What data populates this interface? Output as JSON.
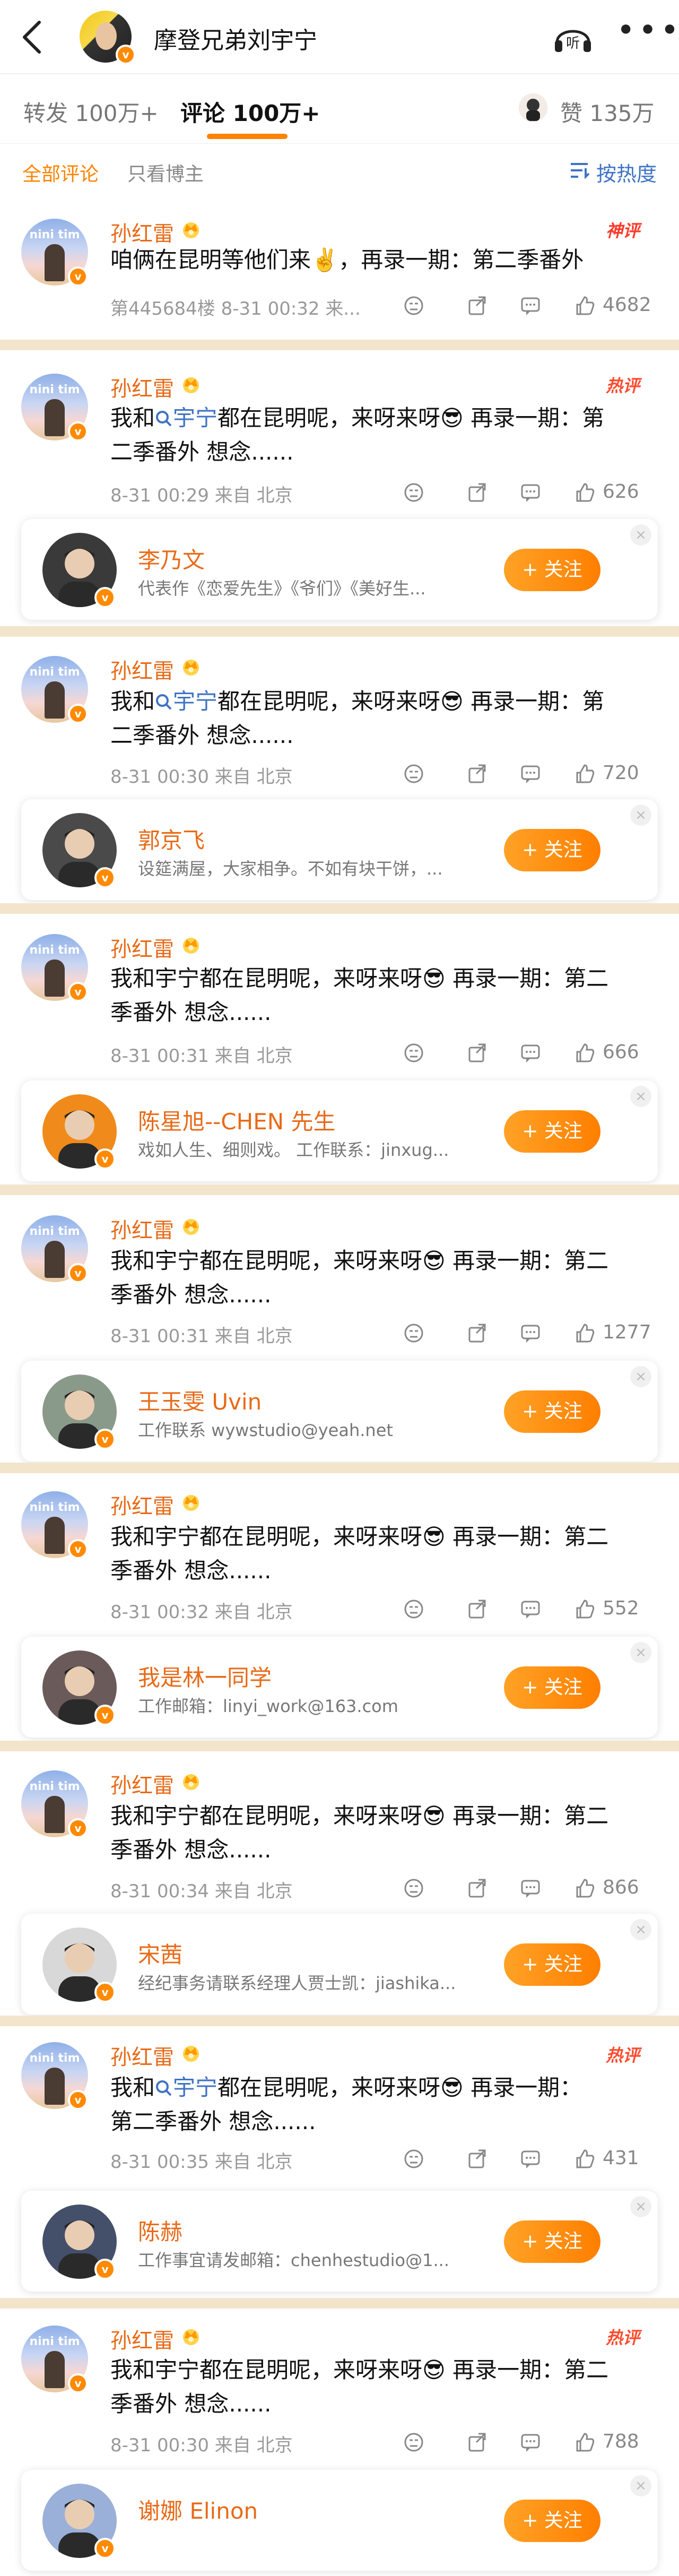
{
  "nav": {
    "title": "摩登兄弟刘宇宁",
    "listen_label": "听",
    "more_label": "•••"
  },
  "tabs": {
    "repost": "转发 100万+",
    "comment": "评论 100万+",
    "like": "赞 135万"
  },
  "filter": {
    "all": "全部评论",
    "owner_only": "只看博主",
    "sort": "按热度"
  },
  "colors": {
    "accent": "#ff8200",
    "username": "#e86a17",
    "link": "#3f73c5",
    "divider": "#f3e5cb"
  },
  "comments": [
    {
      "user": "孙红雷",
      "tag": "神评",
      "text_parts": [
        "咱俩在昆明等他们来✌️，再录一期：第二季番外"
      ],
      "meta": "第445684楼 8-31 00:32 来...",
      "likes": "4682"
    },
    {
      "user": "孙红雷",
      "tag": "热评",
      "text_parts": [
        "我和",
        "宇宁",
        "都在昆明呢，来呀来呀😎 再录一期：第",
        "二季番外 想念......"
      ],
      "meta": "8-31 00:29  来自 北京",
      "likes": "626",
      "card": {
        "name": "李乃文",
        "desc": "代表作《恋爱先生》《爷们》《美好生..."
      }
    },
    {
      "user": "孙红雷",
      "tag": "",
      "text_parts": [
        "我和",
        "宇宁",
        "都在昆明呢，来呀来呀😎 再录一期：第",
        "二季番外 想念......"
      ],
      "meta": "8-31 00:30  来自 北京",
      "likes": "720",
      "card": {
        "name": "郭京飞",
        "desc": "设筵满屋，大家相争。不如有块干饼，..."
      }
    },
    {
      "user": "孙红雷",
      "tag": "",
      "text_parts": [
        "我和宇宁都在昆明呢，来呀来呀😎 再录一期：第二",
        "季番外 想念......"
      ],
      "meta": "8-31 00:31  来自 北京",
      "likes": "666",
      "card": {
        "name": "陈星旭--CHEN 先生",
        "desc": "戏如人生、细则戏。 工作联系：jinxug..."
      }
    },
    {
      "user": "孙红雷",
      "tag": "",
      "text_parts": [
        "我和宇宁都在昆明呢，来呀来呀😎 再录一期：第二",
        "季番外 想念......"
      ],
      "meta": "8-31 00:31  来自 北京",
      "likes": "1277",
      "card": {
        "name": "王玉雯 Uvin",
        "desc": "工作联系 wywstudio@yeah.net"
      }
    },
    {
      "user": "孙红雷",
      "tag": "",
      "text_parts": [
        "我和宇宁都在昆明呢，来呀来呀😎 再录一期：第二",
        "季番外 想念......"
      ],
      "meta": "8-31 00:32  来自 北京",
      "likes": "552",
      "card": {
        "name": "我是林一同学",
        "desc": "工作邮箱：linyi_work@163.com"
      }
    },
    {
      "user": "孙红雷",
      "tag": "",
      "text_parts": [
        "我和宇宁都在昆明呢，来呀来呀😎 再录一期：第二",
        "季番外 想念......"
      ],
      "meta": "8-31 00:34  来自 北京",
      "likes": "866",
      "card": {
        "name": "宋茜",
        "desc": "经纪事务请联系经理人贾士凯：jiashika..."
      }
    },
    {
      "user": "孙红雷",
      "tag": "热评",
      "text_parts": [
        "我和",
        "宇宁",
        "都在昆明呢，来呀来呀😎  再录一期：",
        "第二季番外  想念......"
      ],
      "meta": "8-31 00:35  来自 北京",
      "likes": "431",
      "card": {
        "name": "陈赫",
        "desc": "工作事宜请发邮箱：chenhestudio@1..."
      }
    },
    {
      "user": "孙红雷",
      "tag": "热评",
      "text_parts": [
        "我和宇宁都在昆明呢，来呀来呀😎 再录一期：第二",
        "季番外 想念......"
      ],
      "meta": "8-31 00:30  来自 北京",
      "likes": "788",
      "card": {
        "name": "谢娜 Elinon",
        "desc": ""
      }
    }
  ],
  "follow_label": "+ 关注",
  "close_label": "×",
  "avatar_text": "nini tim"
}
